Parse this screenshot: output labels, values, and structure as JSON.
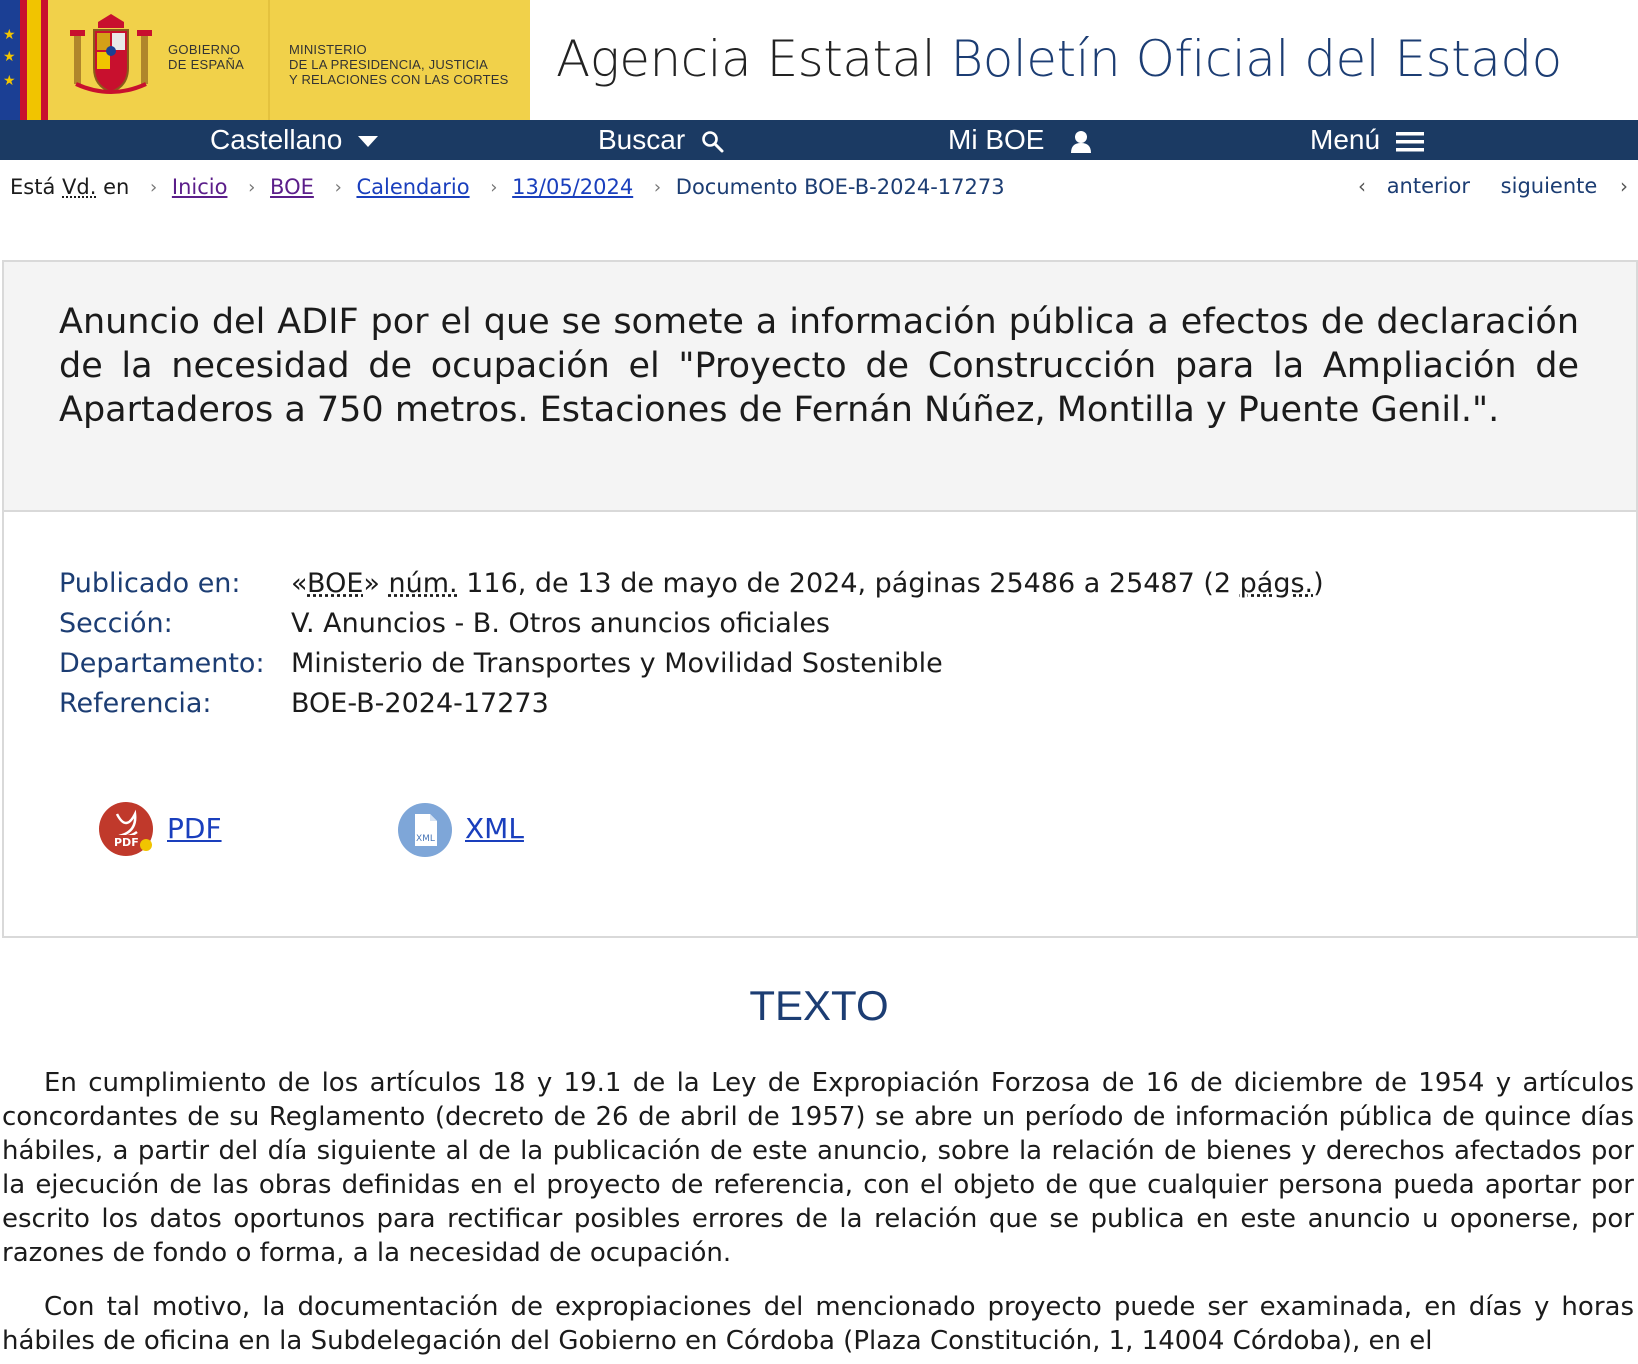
{
  "header": {
    "gov_line1": "GOBIERNO",
    "gov_line2": "DE ESPAÑA",
    "ministry_line1": "MINISTERIO",
    "ministry_line2": "DE LA PRESIDENCIA, JUSTICIA",
    "ministry_line3": "Y RELACIONES CON LAS CORTES",
    "title_prefix": "Agencia Estatal",
    "title_main": "Boletín Oficial del Estado"
  },
  "nav": {
    "language": "Castellano",
    "search": "Buscar",
    "mi_boe": "Mi BOE",
    "menu": "Menú"
  },
  "breadcrumb": {
    "intro_a": "Está",
    "intro_abbr": "Vd.",
    "intro_b": "en",
    "items": [
      "Inicio",
      "BOE",
      "Calendario",
      "13/05/2024"
    ],
    "current": "Documento BOE-B-2024-17273"
  },
  "pager": {
    "previous": "anterior",
    "next": "siguiente"
  },
  "document": {
    "title": "Anuncio del ADIF por el que se somete a información pública a efectos de declaración de la necesidad de ocupación el \"Proyecto de Construcción para la Ampliación de Apartaderos a 750 metros. Estaciones de Fernán Núñez, Montilla y Puente Genil.\".",
    "meta": {
      "published_label": "Publicado en:",
      "published_pre": "«",
      "published_boe": "BOE",
      "published_mid": "» ",
      "published_num": "núm.",
      "published_rest": " 116, de 13 de mayo de 2024, páginas 25486 a 25487 (2 ",
      "published_pags": "págs.",
      "published_end": ")",
      "section_label": "Sección:",
      "section_value": "V. Anuncios - B. Otros anuncios oficiales",
      "department_label": "Departamento:",
      "department_value": "Ministerio de Transportes y Movilidad Sostenible",
      "reference_label": "Referencia:",
      "reference_value": "BOE-B-2024-17273"
    },
    "downloads": {
      "pdf": "PDF",
      "xml": "XML",
      "pdf_icon_text": "PDF",
      "xml_icon_text": "XML"
    }
  },
  "body": {
    "section_title": "TEXTO",
    "paragraph1": "En cumplimiento de los artículos 18 y 19.1 de la Ley de Expropiación Forzosa de 16 de diciembre de 1954 y artículos concordantes de su Reglamento (decreto de 26 de abril de 1957) se abre un período de información pública de quince días hábiles, a partir del día siguiente al de la publicación de este anuncio, sobre la relación de bienes y derechos afectados por la ejecución de las obras definidas en el proyecto de referencia, con el objeto de que cualquier persona pueda aportar por escrito los datos oportunos para rectificar posibles errores de la relación que se publica en este anuncio u oponerse, por razones de fondo o forma, a la necesidad de ocupación.",
    "paragraph2": "Con tal motivo, la documentación de expropiaciones del mencionado proyecto puede ser examinada, en días y horas hábiles de oficina en la Subdelegación del Gobierno en Córdoba (Plaza Constitución, 1, 14004 Córdoba), en el"
  },
  "colors": {
    "nav_bg": "#1b3a63",
    "accent_blue": "#1c3d73",
    "gov_yellow": "#f1d14a",
    "link_blue": "#1a3fbd",
    "visited_purple": "#5b1e8a",
    "pdf_red": "#c0392b",
    "xml_blue": "#7ea6d8"
  }
}
